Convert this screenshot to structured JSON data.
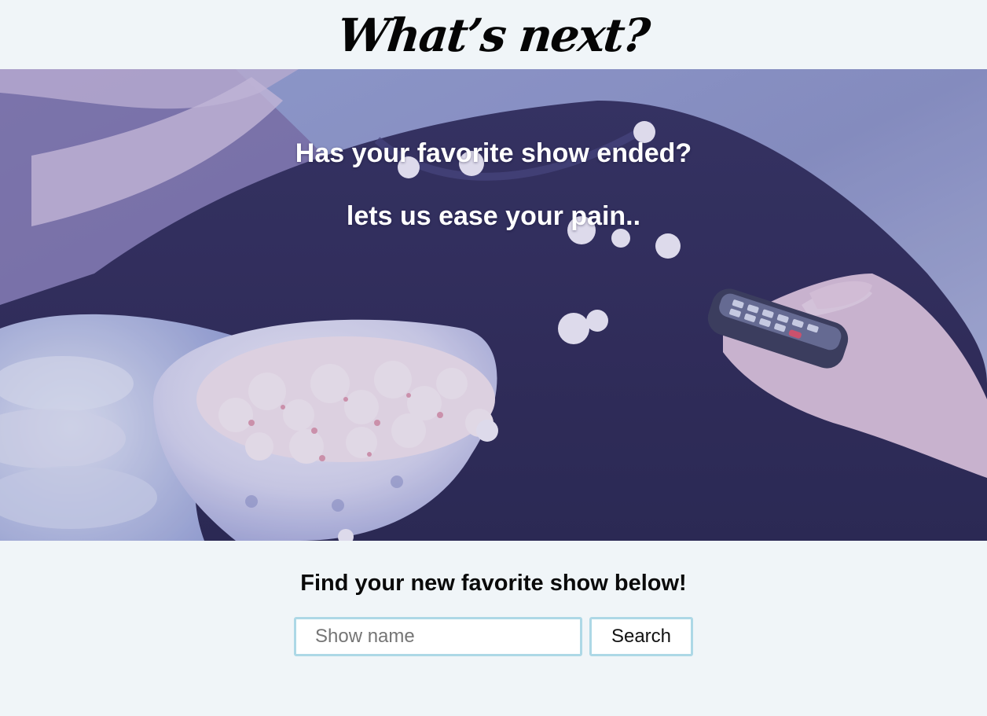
{
  "header": {
    "logo_text": "What’s next?"
  },
  "hero": {
    "line_1": "Has your favorite show ended?",
    "line_2": "lets us ease your pain.."
  },
  "search": {
    "heading": "Find your new favorite show below!",
    "input_placeholder": "Show name",
    "input_value": "",
    "button_label": "Search"
  },
  "colors": {
    "page_background": "#f0f5f8",
    "input_border": "#add8e6",
    "hero_overlay": "#3b3a7a"
  }
}
